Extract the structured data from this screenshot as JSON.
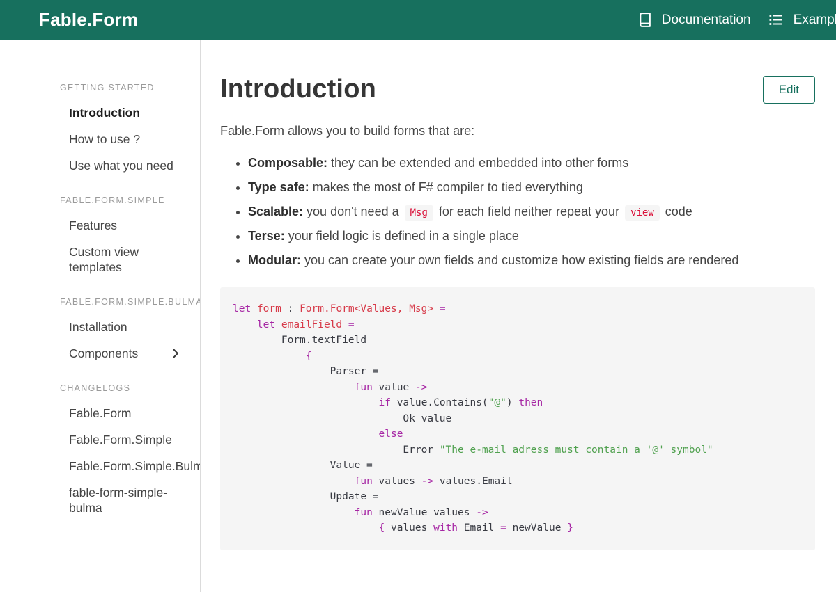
{
  "colors": {
    "accent": "#17705e",
    "inline_code_text": "#da1039",
    "code_background": "#f5f5f5",
    "code_keyword": "#a626a4",
    "code_string": "#50a14f",
    "code_identifier": "#d73a49"
  },
  "navbar": {
    "brand": "Fable.Form",
    "links": [
      {
        "label": "Documentation",
        "icon": "book-icon"
      },
      {
        "label": "Examples",
        "icon": "list-icon"
      }
    ]
  },
  "sidebar": {
    "sections": [
      {
        "title": "GETTING STARTED",
        "items": [
          {
            "label": "Introduction",
            "active": true
          },
          {
            "label": "How to use ?"
          },
          {
            "label": "Use what you need"
          }
        ]
      },
      {
        "title": "FABLE.FORM.SIMPLE",
        "items": [
          {
            "label": "Features"
          },
          {
            "label": "Custom view templates"
          }
        ]
      },
      {
        "title": "FABLE.FORM.SIMPLE.BULMA",
        "items": [
          {
            "label": "Installation"
          },
          {
            "label": "Components",
            "chevron": true
          }
        ]
      },
      {
        "title": "CHANGELOGS",
        "items": [
          {
            "label": "Fable.Form"
          },
          {
            "label": "Fable.Form.Simple"
          },
          {
            "label": "Fable.Form.Simple.Bulma"
          },
          {
            "label": "fable-form-simple-bulma"
          }
        ]
      }
    ]
  },
  "main": {
    "title": "Introduction",
    "edit_label": "Edit",
    "intro": "Fable.Form allows you to build forms that are:",
    "bullets": [
      {
        "segments": [
          {
            "t": "bold",
            "text": "Composable:"
          },
          {
            "t": "text",
            "text": " they can be extended and embedded into other forms"
          }
        ]
      },
      {
        "segments": [
          {
            "t": "bold",
            "text": "Type safe:"
          },
          {
            "t": "text",
            "text": " makes the most of F# compiler to tied everything"
          }
        ]
      },
      {
        "segments": [
          {
            "t": "bold",
            "text": "Scalable:"
          },
          {
            "t": "text",
            "text": " you don't need a "
          },
          {
            "t": "code",
            "text": "Msg"
          },
          {
            "t": "text",
            "text": " for each field neither repeat your "
          },
          {
            "t": "code",
            "text": "view"
          },
          {
            "t": "text",
            "text": " code"
          }
        ]
      },
      {
        "segments": [
          {
            "t": "bold",
            "text": "Terse:"
          },
          {
            "t": "text",
            "text": " your field logic is defined in a single place"
          }
        ]
      },
      {
        "segments": [
          {
            "t": "bold",
            "text": "Modular:"
          },
          {
            "t": "text",
            "text": " you can create your own fields and customize how existing fields are rendered"
          }
        ]
      }
    ],
    "code_block": {
      "language": "fsharp",
      "lines": [
        [
          [
            "k",
            "let"
          ],
          [
            "p",
            " "
          ],
          [
            "i",
            "form"
          ],
          [
            "p",
            " : "
          ],
          [
            "i",
            "Form.Form<Values, Msg>"
          ],
          [
            "p",
            " "
          ],
          [
            "k",
            "="
          ]
        ],
        [
          [
            "p",
            "    "
          ],
          [
            "k",
            "let"
          ],
          [
            "p",
            " "
          ],
          [
            "i",
            "emailField"
          ],
          [
            "p",
            " "
          ],
          [
            "k",
            "="
          ]
        ],
        [
          [
            "p",
            "        Form.textField"
          ]
        ],
        [
          [
            "p",
            "            "
          ],
          [
            "k",
            "{"
          ]
        ],
        [
          [
            "p",
            "                Parser ="
          ]
        ],
        [
          [
            "p",
            "                    "
          ],
          [
            "k",
            "fun"
          ],
          [
            "p",
            " value "
          ],
          [
            "k",
            "->"
          ]
        ],
        [
          [
            "p",
            "                        "
          ],
          [
            "k",
            "if"
          ],
          [
            "p",
            " value.Contains("
          ],
          [
            "s",
            "\"@\""
          ],
          [
            "p",
            ") "
          ],
          [
            "k",
            "then"
          ]
        ],
        [
          [
            "p",
            "                            Ok value"
          ]
        ],
        [
          [
            "p",
            "                        "
          ],
          [
            "k",
            "else"
          ]
        ],
        [
          [
            "p",
            "                            Error "
          ],
          [
            "s",
            "\"The e-mail adress must contain a '@' symbol\""
          ]
        ],
        [
          [
            "p",
            "                Value ="
          ]
        ],
        [
          [
            "p",
            "                    "
          ],
          [
            "k",
            "fun"
          ],
          [
            "p",
            " values "
          ],
          [
            "k",
            "->"
          ],
          [
            "p",
            " values.Email"
          ]
        ],
        [
          [
            "p",
            "                Update ="
          ]
        ],
        [
          [
            "p",
            "                    "
          ],
          [
            "k",
            "fun"
          ],
          [
            "p",
            " newValue values "
          ],
          [
            "k",
            "->"
          ]
        ],
        [
          [
            "p",
            "                        "
          ],
          [
            "k",
            "{"
          ],
          [
            "p",
            " values "
          ],
          [
            "k",
            "with"
          ],
          [
            "p",
            " Email "
          ],
          [
            "k",
            "="
          ],
          [
            "p",
            " newValue "
          ],
          [
            "k",
            "}"
          ]
        ]
      ]
    }
  }
}
